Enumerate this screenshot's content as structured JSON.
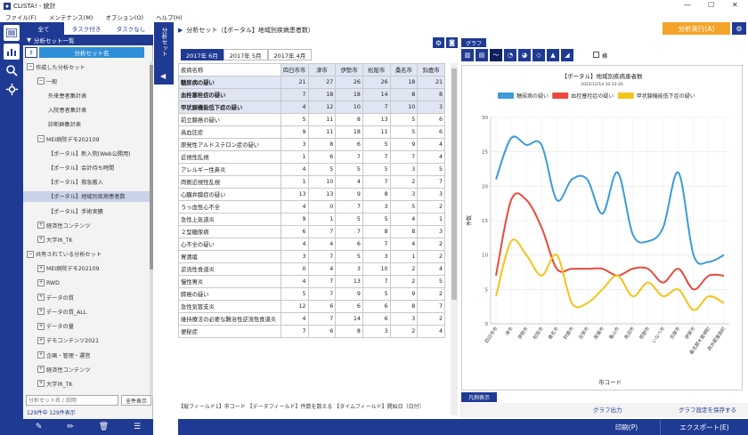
{
  "window": {
    "title": "CLISTA! - 統計",
    "icon": "app-icon"
  },
  "menu": [
    "ファイル(F)",
    "メンテナンス(M)",
    "オプション(O)",
    "ヘルプ(H)"
  ],
  "left": {
    "tabs": [
      "全て",
      "タスク付き",
      "タスクなし"
    ],
    "list_title": "分析セット一覧",
    "sort_label": "分析セット名",
    "tree": [
      {
        "label": "作成した分析セット",
        "level": 0,
        "box": "⊟"
      },
      {
        "label": "一般",
        "level": 1,
        "box": "⊟"
      },
      {
        "label": "外来患者集計表",
        "level": 2
      },
      {
        "label": "入院患者集計表",
        "level": 2
      },
      {
        "label": "診断群集計表",
        "level": 2
      },
      {
        "label": "MEI病院デモ202109",
        "level": 1,
        "box": "⊟"
      },
      {
        "label": "【ポータル】新入院(Web公開用)",
        "level": 2
      },
      {
        "label": "【ポータル】会計待ち時間",
        "level": 2
      },
      {
        "label": "【ポータル】救急搬入",
        "level": 2
      },
      {
        "label": "【ポータル】地域別疾病患者数",
        "level": 2,
        "selected": true
      },
      {
        "label": "【ポータル】手術実績",
        "level": 2
      },
      {
        "label": "経済性コンテンツ",
        "level": 1,
        "box": "⊞"
      },
      {
        "label": "大学IR_TK",
        "level": 1,
        "box": "⊞"
      },
      {
        "label": "共有されている分析セット",
        "level": 0,
        "box": "⊟"
      },
      {
        "label": "MEI病院デモ202109",
        "level": 1,
        "box": "⊞"
      },
      {
        "label": "RWD",
        "level": 1,
        "box": "⊞"
      },
      {
        "label": "データの質",
        "level": 1,
        "box": "⊞"
      },
      {
        "label": "データの質_ALL",
        "level": 1,
        "box": "⊞"
      },
      {
        "label": "データの量",
        "level": 1,
        "box": "⊞"
      },
      {
        "label": "デモコンテンツ2021",
        "level": 1,
        "box": "⊞"
      },
      {
        "label": "企画・管理・運営",
        "level": 1,
        "box": "⊞"
      },
      {
        "label": "経済性コンテンツ",
        "level": 1,
        "box": "⊞"
      },
      {
        "label": "大学IR_TK",
        "level": 1,
        "box": "⊞"
      }
    ],
    "search_placeholder": "分析セット名 / 説明",
    "show_all": "全件表示",
    "count": "129件中 129件表示"
  },
  "side_tab": "分析セット",
  "center": {
    "title": "分析セット（【ポータル】地域別疾病患者数）",
    "tabs": [
      "2017年 6月",
      "2017年 5月",
      "2017年 4月"
    ],
    "columns": [
      "疾病名称",
      "四日市市",
      "津市",
      "伊勢市",
      "松阪市",
      "桑名市",
      "鈴鹿市"
    ],
    "rows": [
      [
        "糖尿病の疑い",
        "21",
        "27",
        "26",
        "26",
        "18",
        "21"
      ],
      [
        "血栓塞栓症の疑い",
        "7",
        "18",
        "18",
        "14",
        "8",
        "8"
      ],
      [
        "甲状腺機能低下症の疑い",
        "4",
        "12",
        "10",
        "7",
        "10",
        "3"
      ],
      [
        "前立腺癌の疑い",
        "5",
        "11",
        "8",
        "13",
        "5",
        "6"
      ],
      [
        "高血圧症",
        "9",
        "11",
        "18",
        "11",
        "5",
        "6"
      ],
      [
        "原発性アルドステロン症の疑い",
        "3",
        "8",
        "6",
        "5",
        "9",
        "4"
      ],
      [
        "近視性乱視",
        "1",
        "6",
        "7",
        "7",
        "7",
        "4"
      ],
      [
        "アレルギー性鼻炎",
        "4",
        "5",
        "5",
        "5",
        "3",
        "5"
      ],
      [
        "両側近視性乱視",
        "1",
        "10",
        "4",
        "7",
        "2",
        "7"
      ],
      [
        "心臓弁膜症の疑い",
        "13",
        "13",
        "9",
        "8",
        "3",
        "3"
      ],
      [
        "うっ血性心不全",
        "4",
        "0",
        "7",
        "3",
        "5",
        "2"
      ],
      [
        "急性上気道炎",
        "9",
        "1",
        "5",
        "5",
        "4",
        "1"
      ],
      [
        "２型糖尿病",
        "6",
        "7",
        "7",
        "8",
        "8",
        "3"
      ],
      [
        "心不全の疑い",
        "4",
        "4",
        "6",
        "7",
        "4",
        "2"
      ],
      [
        "胃潰瘍",
        "3",
        "7",
        "5",
        "3",
        "1",
        "2"
      ],
      [
        "逆流性食道炎",
        "0",
        "4",
        "3",
        "10",
        "2",
        "4"
      ],
      [
        "慢性胃炎",
        "4",
        "7",
        "13",
        "7",
        "2",
        "5"
      ],
      [
        "膵癌の疑い",
        "5",
        "7",
        "9",
        "5",
        "9",
        "2"
      ],
      [
        "急性気管支炎",
        "12",
        "6",
        "6",
        "6",
        "8",
        "7"
      ],
      [
        "維持療法の必要な難治性逆流性食道炎",
        "4",
        "7",
        "14",
        "6",
        "3",
        "2"
      ],
      [
        "便秘症",
        "7",
        "6",
        "8",
        "3",
        "2",
        "4"
      ]
    ],
    "footer": "【縦フィールド1】市コード 【データフィールド】件数を数える 【タイムフィールド】開始日（日付）"
  },
  "right": {
    "graph_tab": "グラフ",
    "run_button": "分析実行(A)",
    "legend_toggle": "凡例表示",
    "grid_check": "横",
    "graph_output": "グラフ出力",
    "save_settings": "グラフ設定を保存する",
    "print": "印刷(P)",
    "export": "エクスポート(E)"
  },
  "chart_data": {
    "type": "line",
    "title": "【ポータル】地域別疾病患者数",
    "subtitle": "2022/12/14 10:33:26",
    "xlabel": "市コード",
    "ylabel": "件数",
    "ylim": [
      0,
      30
    ],
    "yticks": [
      0,
      5,
      10,
      15,
      20,
      25,
      30
    ],
    "categories": [
      "四日市市",
      "津市",
      "伊勢市",
      "松阪市",
      "桑名市",
      "鈴鹿市",
      "名張市",
      "尾鷲市",
      "亀山市",
      "鳥羽市",
      "熊野市",
      "いなべ市",
      "志摩市",
      "伊賀市",
      "桑名郡木曽岬町",
      "員弁郡東員町"
    ],
    "series": [
      {
        "name": "糖尿病の疑い",
        "color": "#3b9bd9",
        "values": [
          21,
          27,
          26,
          26,
          18,
          21,
          21,
          16,
          22,
          13,
          12,
          14,
          22,
          10,
          9,
          10
        ]
      },
      {
        "name": "血栓塞栓症の疑い",
        "color": "#e84a3c",
        "values": [
          7,
          18,
          18,
          14,
          8,
          8,
          8,
          8,
          7,
          8,
          8,
          6,
          8,
          5,
          7,
          7
        ]
      },
      {
        "name": "甲状腺機能低下症の疑い",
        "color": "#f2c51c",
        "values": [
          4,
          12,
          10,
          7,
          10,
          3,
          3,
          5,
          7,
          4,
          6,
          4,
          5,
          2,
          4,
          3
        ]
      }
    ],
    "grid": true,
    "legend": "top"
  }
}
